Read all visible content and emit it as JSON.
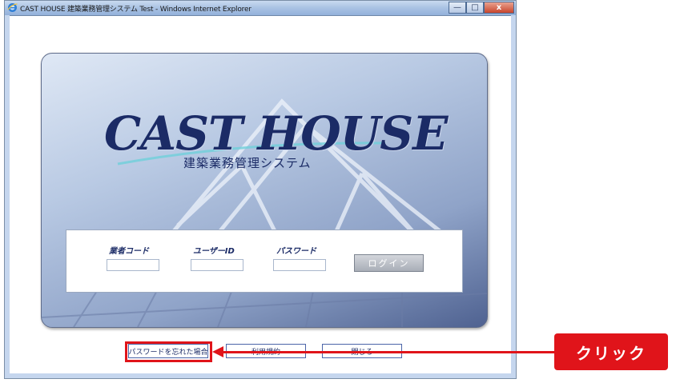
{
  "window": {
    "title": "CAST HOUSE 建築業務管理システム Test - Windows Internet Explorer",
    "minimize_glyph": "—",
    "maximize_glyph": "□",
    "close_glyph": "x"
  },
  "branding": {
    "logo_text": "CAST HOUSE",
    "subtitle": "建築業務管理システム"
  },
  "login": {
    "company_code_label": "業者コード",
    "company_code_value": "",
    "user_id_label": "ユーザーID",
    "user_id_value": "",
    "password_label": "パスワード",
    "password_value": "",
    "login_button": "ログイン"
  },
  "footer_buttons": {
    "forgot_password": "パスワードを忘れた場合",
    "terms": "利用規約",
    "close": "閉じる"
  },
  "annotation": {
    "callout": "クリック",
    "color": "#e0141a"
  },
  "colors": {
    "brand_navy": "#1b2b66",
    "title_bar": "#a9c2e3"
  }
}
